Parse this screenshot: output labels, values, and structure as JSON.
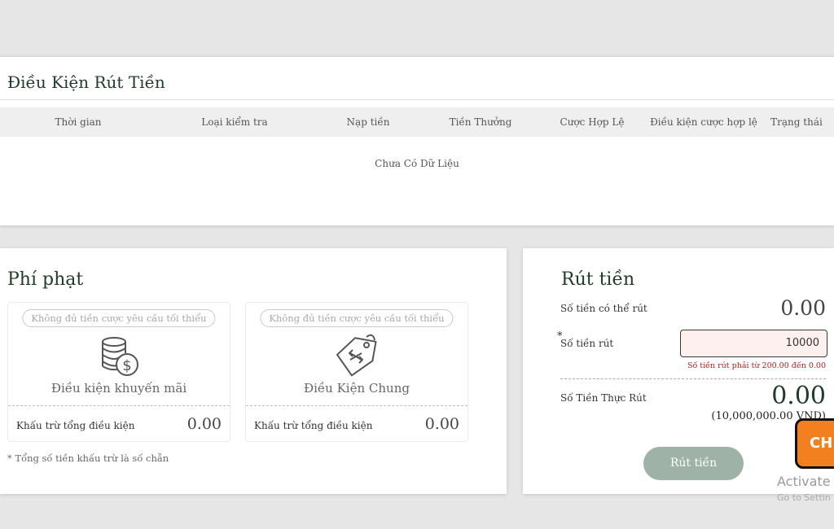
{
  "conditions": {
    "title": "Điều Kiện Rút Tiền",
    "columns": [
      "Thời gian",
      "Loại kiểm tra",
      "Nạp tiền",
      "Tiền Thưởng",
      "Cược Hợp Lệ",
      "Điều kiện cược hợp lệ",
      "Trạng thái"
    ],
    "empty_text": "Chưa Có Dữ Liệu"
  },
  "penalty": {
    "title": "Phí phạt",
    "cards": [
      {
        "badge": "Không đủ tiền cược yêu cầu tối thiểu",
        "label": "Điều kiện khuyến mãi",
        "footer_label": "Khấu trừ tổng điều kiện",
        "footer_value": "0.00",
        "icon": "coins-dollar-icon"
      },
      {
        "badge": "Không đủ tiền cược yêu cầu tối thiểu",
        "label": "Điều Kiện Chung",
        "footer_label": "Khấu trừ tổng điều kiện",
        "footer_value": "0.00",
        "icon": "price-tag-icon"
      }
    ],
    "note": "* Tổng số tiền khấu trừ là số chẵn"
  },
  "withdraw": {
    "title": "Rút tiền",
    "available_label": "Số tiền có thể rút",
    "available_value": "0.00",
    "required_mark": "*",
    "amount_label": "Số tiền rút",
    "amount_value": "10000",
    "amount_error": "Số tiền rút phải từ 200.00 đến 0.00",
    "actual_label": "Số Tiền Thực Rút",
    "actual_value": "0.00",
    "actual_vnd": "(10,000,000.00 VND)",
    "submit_label": "Rút tiền"
  },
  "overlays": {
    "chat_label": "CH",
    "activate_line1": "Activate",
    "activate_line2": "Go to Settin"
  },
  "colors": {
    "heading": "#1f3b2a",
    "button": "#9fb2a8",
    "error": "#b02020",
    "input_bg": "#fff0f0",
    "chat": "#f2801f"
  }
}
